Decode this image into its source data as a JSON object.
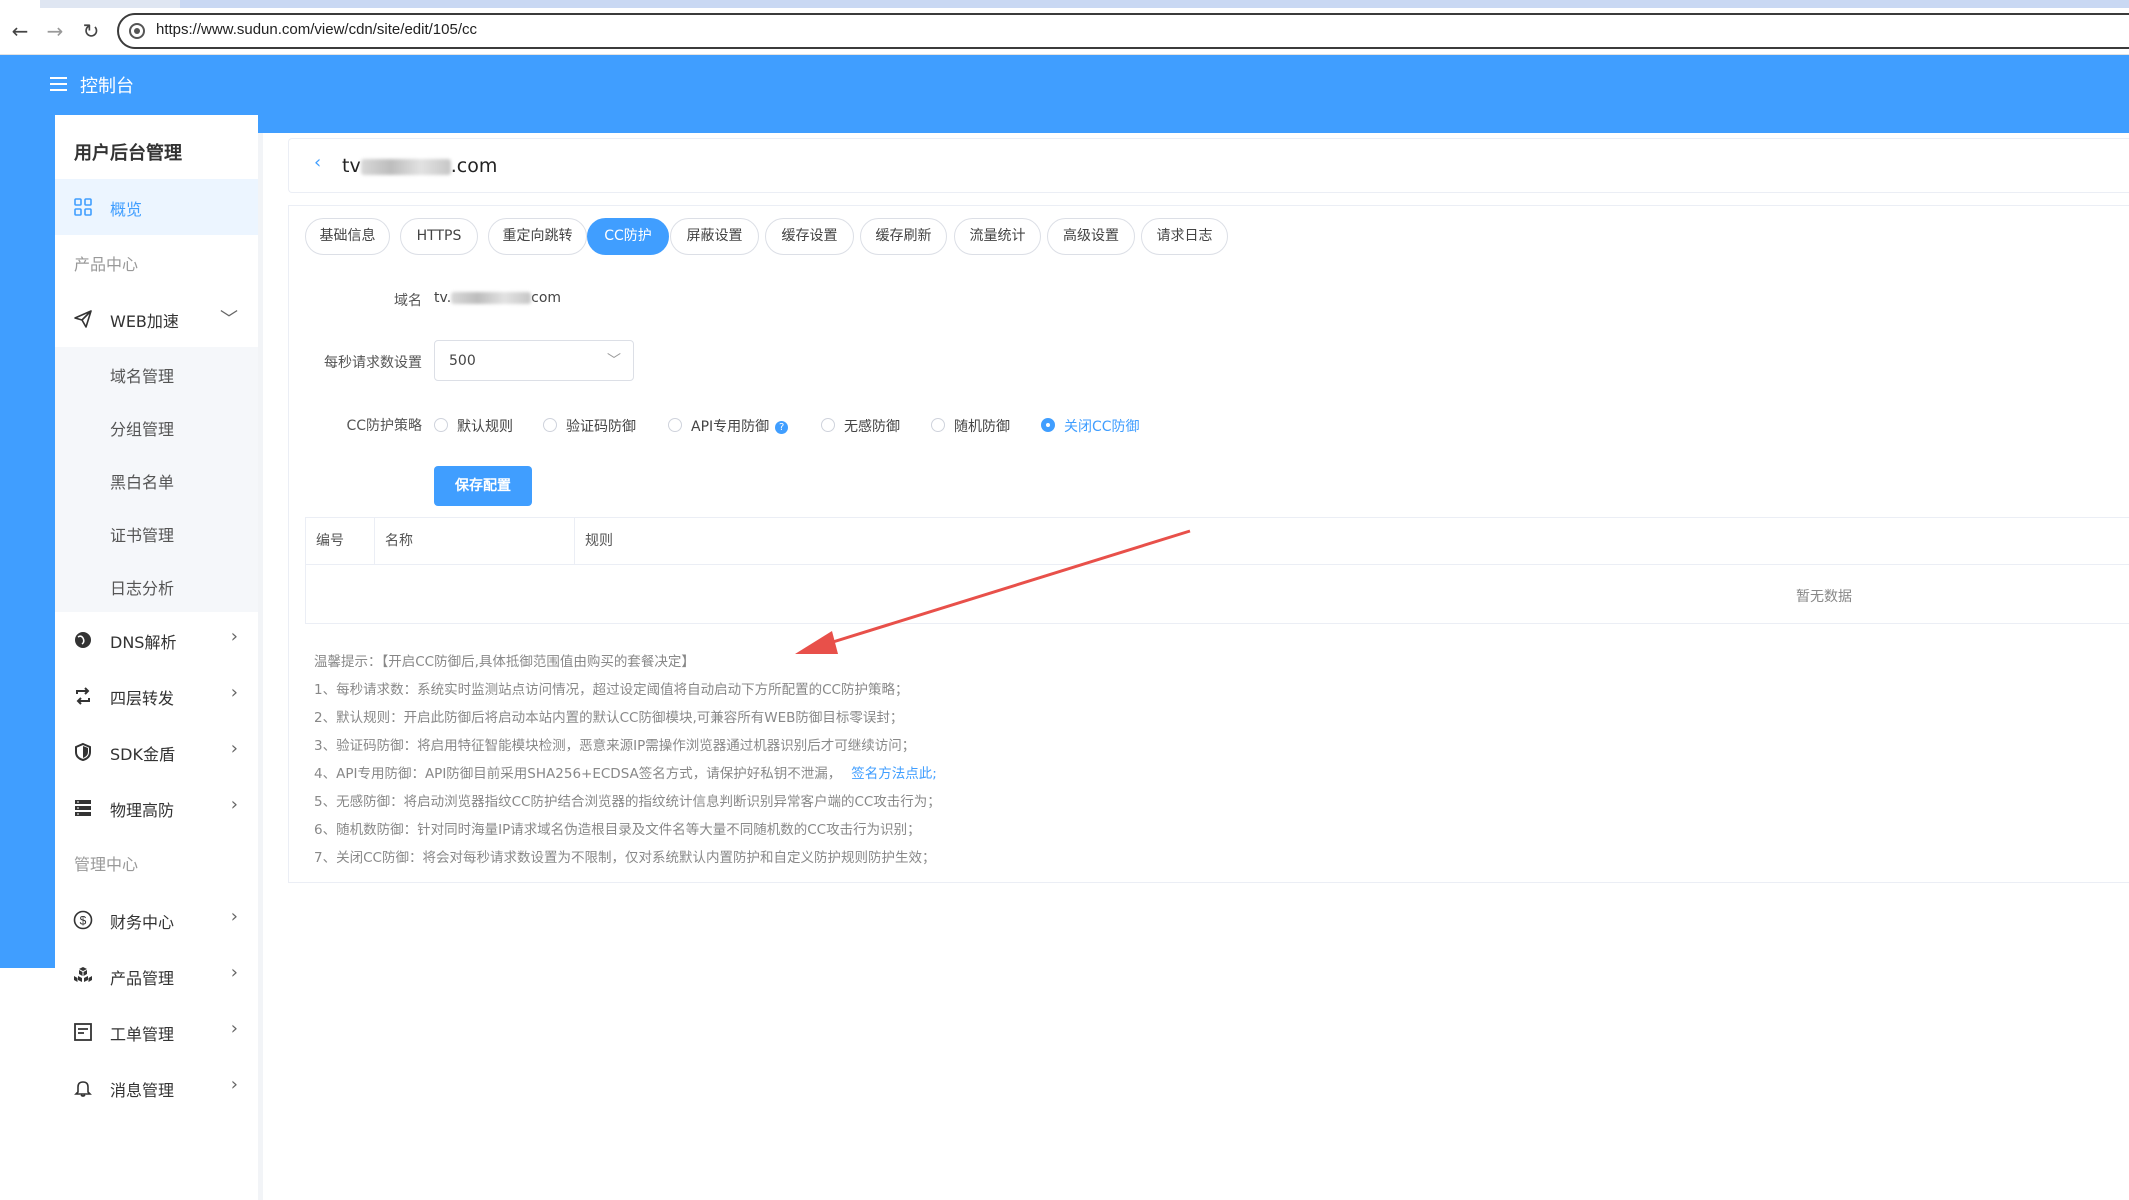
{
  "browser": {
    "url": "https://www.sudun.com/view/cdn/site/edit/105/cc"
  },
  "header": {
    "title": "控制台"
  },
  "sidebar": {
    "heading": "用户后台管理",
    "overview": "概览",
    "group_product": "产品中心",
    "web_accel": "WEB加速",
    "sub_items": [
      "域名管理",
      "分组管理",
      "黑白名单",
      "证书管理",
      "日志分析"
    ],
    "dns": "DNS解析",
    "l4": "四层转发",
    "sdk": "SDK金盾",
    "physical": "物理高防",
    "group_manage": "管理中心",
    "finance": "财务中心",
    "product_manage": "产品管理",
    "ticket": "工单管理",
    "message": "消息管理"
  },
  "site": {
    "domain_prefix": "tv",
    "domain_suffix": ".com"
  },
  "tabs": [
    "基础信息",
    "HTTPS",
    "重定向跳转",
    "CC防护",
    "屏蔽设置",
    "缓存设置",
    "缓存刷新",
    "流量统计",
    "高级设置",
    "请求日志"
  ],
  "active_tab": "CC防护",
  "form": {
    "domain_label": "域名",
    "domain_value_prefix": "tv.",
    "domain_value_suffix": "com",
    "rps_label": "每秒请求数设置",
    "rps_value": "500",
    "policy_label": "CC防护策略",
    "policies": [
      "默认规则",
      "验证码防御",
      "API专用防御",
      "无感防御",
      "随机防御",
      "关闭CC防御"
    ],
    "selected_policy": "关闭CC防御",
    "help_mark": "?",
    "save_label": "保存配置"
  },
  "table": {
    "columns": [
      "编号",
      "名称",
      "规则"
    ],
    "empty_text": "暂无数据"
  },
  "tips": {
    "title": "温馨提示：【开启CC防御后,具体抵御范围值由购买的套餐决定】",
    "lines": [
      "1、每秒请求数：系统实时监测站点访问情况，超过设定阈值将自动启动下方所配置的CC防护策略；",
      "2、默认规则：开启此防御后将启动本站内置的默认CC防御模块,可兼容所有WEB防御目标零误封；",
      "3、验证码防御：将启用特征智能模块检测，恶意来源IP需操作浏览器通过机器识别后才可继续访问；",
      "4、API专用防御：API防御目前采用SHA256+ECDSA签名方式，请保护好私钥不泄漏，",
      "5、无感防御：将启动浏览器指纹CC防护结合浏览器的指纹统计信息判断识别异常客户端的CC攻击行为；",
      "6、随机数防御：针对同时海量IP请求域名伪造根目录及文件名等大量不同随机数的CC攻击行为识别；",
      "7、关闭CC防御：将会对每秒请求数设置为不限制，仅对系统默认内置防护和自定义防护规则防护生效；"
    ],
    "link_text": "签名方法点此",
    "link_suffix": ";"
  },
  "colors": {
    "primary": "#409eff",
    "arrow": "#e8504a"
  }
}
